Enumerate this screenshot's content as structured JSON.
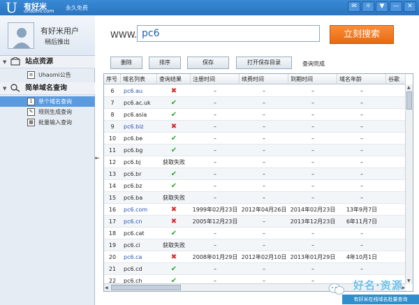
{
  "app": {
    "logo": "U",
    "name": "有好米",
    "domain": "uhaomi.com",
    "tagline": "永久免费"
  },
  "window_buttons": [
    "chat-icon",
    "skin-icon",
    "menu-icon",
    "minimize-icon",
    "close-icon"
  ],
  "sidebar": {
    "user_name": "有好米用户",
    "logout": "稍后推出",
    "sections": [
      {
        "label": "站点资源",
        "icon": "site-icon",
        "items": [
          {
            "label": "Uhaomi公告",
            "icon": "notice-icon"
          }
        ]
      },
      {
        "label": "简单域名查询",
        "icon": "search-icon",
        "items": [
          {
            "label": "单个域名查询",
            "icon": "number-1-icon",
            "badge": "1",
            "active": true
          },
          {
            "label": "规则生成查询",
            "icon": "rule-icon",
            "active": false
          },
          {
            "label": "批量输入查询",
            "icon": "grid-icon",
            "active": false
          }
        ]
      }
    ]
  },
  "search": {
    "prefix": "WWW.",
    "value": "pc6",
    "button": "立刻搜索"
  },
  "toolbar": {
    "delete": "删除",
    "sort": "排序",
    "save": "保存",
    "open_dir": "打开保存目录",
    "status": "查询完成"
  },
  "table": {
    "headers": [
      "序号",
      "域名列表",
      "查询结果",
      "注册时间",
      "续费时间",
      "到期时间",
      "域名年龄",
      "谷歌"
    ],
    "rows": [
      {
        "n": "6",
        "domain": "pc6.au",
        "result": "no",
        "reg": "–",
        "renew": "–",
        "exp": "–",
        "age": "–"
      },
      {
        "n": "7",
        "domain": "pc6.ac.uk",
        "result": "ok",
        "reg": "–",
        "renew": "–",
        "exp": "–",
        "age": "–"
      },
      {
        "n": "8",
        "domain": "pc6.asia",
        "result": "ok",
        "reg": "–",
        "renew": "–",
        "exp": "–",
        "age": "–"
      },
      {
        "n": "9",
        "domain": "pc6.biz",
        "result": "no",
        "reg": "–",
        "renew": "–",
        "exp": "–",
        "age": "–"
      },
      {
        "n": "10",
        "domain": "pc6.be",
        "result": "ok",
        "reg": "–",
        "renew": "–",
        "exp": "–",
        "age": "–"
      },
      {
        "n": "11",
        "domain": "pc6.bg",
        "result": "ok",
        "reg": "–",
        "renew": "–",
        "exp": "–",
        "age": "–"
      },
      {
        "n": "12",
        "domain": "pc6.bj",
        "result": "获取失败",
        "reg": "–",
        "renew": "–",
        "exp": "–",
        "age": "–"
      },
      {
        "n": "13",
        "domain": "pc6.br",
        "result": "ok",
        "reg": "–",
        "renew": "–",
        "exp": "–",
        "age": "–"
      },
      {
        "n": "14",
        "domain": "pc6.bz",
        "result": "ok",
        "reg": "–",
        "renew": "–",
        "exp": "–",
        "age": "–"
      },
      {
        "n": "15",
        "domain": "pc6.ba",
        "result": "获取失败",
        "reg": "–",
        "renew": "–",
        "exp": "–",
        "age": "–"
      },
      {
        "n": "16",
        "domain": "pc6.com",
        "result": "no",
        "reg": "1999年02月23日",
        "renew": "2012年04月26日",
        "exp": "2014年02月23日",
        "age": "13年9月7日"
      },
      {
        "n": "17",
        "domain": "pc6.cn",
        "result": "no",
        "reg": "2005年12月23日",
        "renew": "–",
        "exp": "2013年12月23日",
        "age": "6年11月7日"
      },
      {
        "n": "18",
        "domain": "pc6.cat",
        "result": "ok",
        "reg": "–",
        "renew": "–",
        "exp": "–",
        "age": "–"
      },
      {
        "n": "19",
        "domain": "pc6.ci",
        "result": "获取失败",
        "reg": "–",
        "renew": "–",
        "exp": "–",
        "age": "–"
      },
      {
        "n": "20",
        "domain": "pc6.ca",
        "result": "no",
        "reg": "2008年01月29日",
        "renew": "2012年02月10日",
        "exp": "2013年01月29日",
        "age": "4年10月1日"
      },
      {
        "n": "21",
        "domain": "pc6.cd",
        "result": "ok",
        "reg": "–",
        "renew": "–",
        "exp": "–",
        "age": "–"
      },
      {
        "n": "22",
        "domain": "pc6.ch",
        "result": "ok",
        "reg": "–",
        "renew": "–",
        "exp": "–",
        "age": "–"
      }
    ]
  },
  "watermark": {
    "big": "好名·资源",
    "small": "有好米在线域名批量查询"
  }
}
